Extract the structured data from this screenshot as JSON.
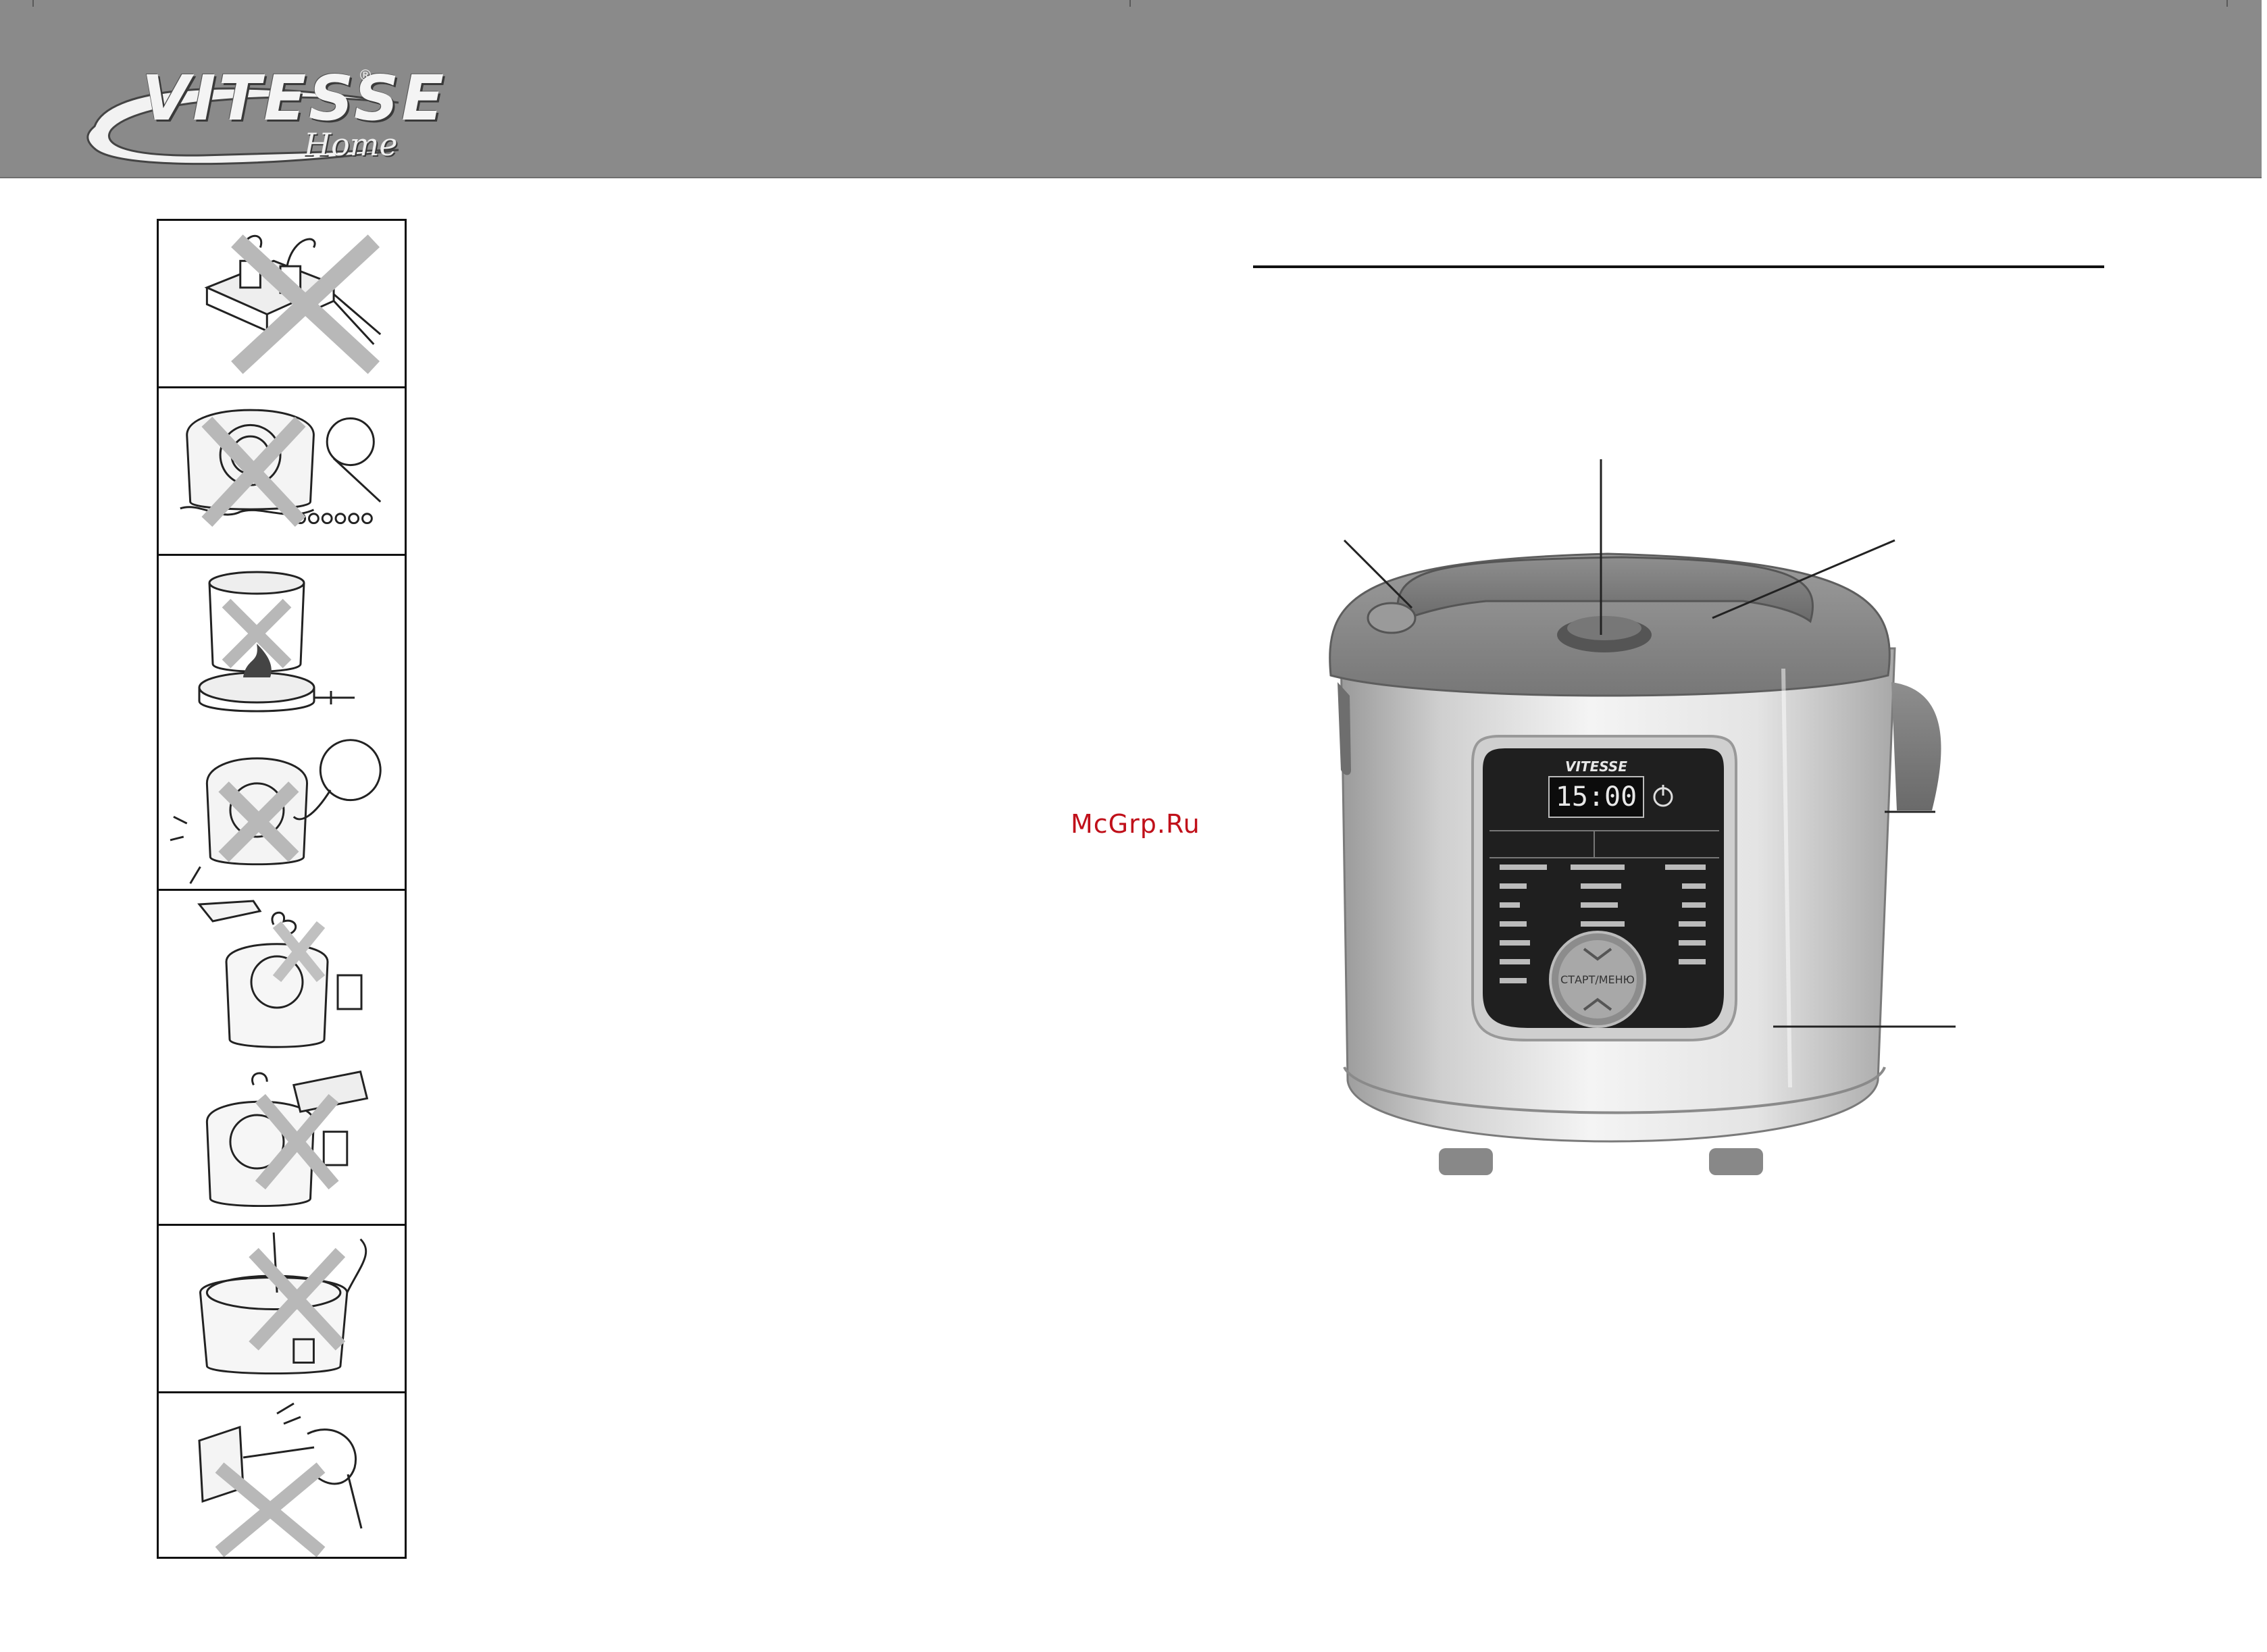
{
  "header": {
    "brand": "VITESSE",
    "brand_sub": "Home",
    "brand_mark": "®"
  },
  "warning_panel": {
    "items": [
      {
        "icon": "no-multi-socket-icon"
      },
      {
        "icon": "no-water-immersion-icon"
      },
      {
        "icon": "no-gas-stove-icon"
      },
      {
        "icon": "no-child-contact-icon"
      },
      {
        "icon": "no-touch-steam-icon"
      },
      {
        "icon": "no-cover-vent-icon"
      },
      {
        "icon": "no-pour-into-base-icon"
      },
      {
        "icon": "no-pull-cord-icon"
      }
    ]
  },
  "watermark": "McGrp.Ru",
  "product": {
    "display_time": "15:00",
    "panel_brand": "VITESSE",
    "start_label": "СТАРТ/МЕНЮ"
  }
}
